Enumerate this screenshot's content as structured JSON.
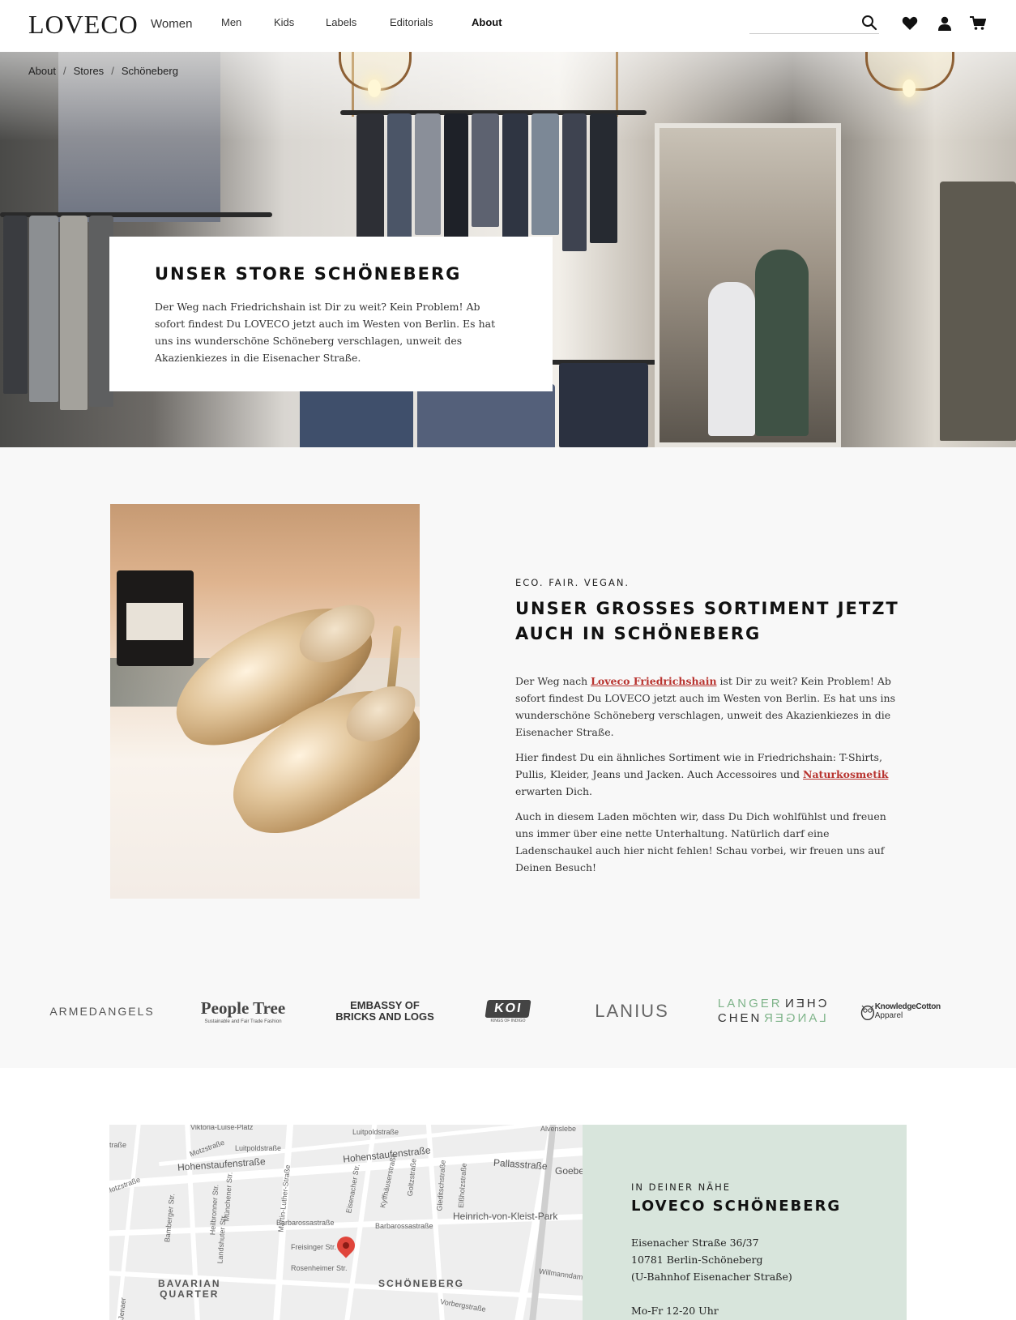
{
  "header": {
    "logo": "LOVECO",
    "nav": [
      {
        "label": "Women"
      },
      {
        "label": "Men"
      },
      {
        "label": "Kids"
      },
      {
        "label": "Labels"
      },
      {
        "label": "Editorials"
      },
      {
        "label": "About"
      }
    ],
    "active_nav": "About",
    "search": {
      "value": "",
      "placeholder": ""
    },
    "icons": [
      "search-icon",
      "heart-icon",
      "user-icon",
      "cart-icon"
    ]
  },
  "breadcrumb": [
    "About",
    "Stores",
    "Schöneberg"
  ],
  "hero": {
    "title": "UNSER STORE SCHÖNEBERG",
    "text": "Der Weg nach Friedrichshain ist Dir zu weit? Kein Problem! Ab sofort findest Du LOVECO jetzt auch im Westen von Berlin. Es hat uns ins wunderschöne Schöneberg verschlagen, unweit des Akazienkiezes in die Eisenacher Straße."
  },
  "sortiment": {
    "eyebrow": "ECO. FAIR. VEGAN.",
    "title": "UNSER GROSSES SORTIMENT JETZT AUCH IN SCHÖNEBERG",
    "p1_before": "Der Weg nach ",
    "p1_link": "Loveco Friedrichshain",
    "p1_after": " ist Dir zu weit? Kein Problem! Ab sofort findest Du LOVECO jetzt auch im Westen von Berlin. Es hat uns ins wunderschöne Schöneberg verschlagen, unweit des Akazienkiezes in die Eisenacher Straße.",
    "p2_before": " Hier findest Du ein ähnliches Sortiment wie in Friedrichshain: T-Shirts, Pullis, Kleider, Jeans und Jacken. Auch Accessoires und ",
    "p2_link": "Naturkosmetik",
    "p2_after": " erwarten Dich.",
    "p3": "Auch in diesem Laden möchten wir, dass Du Dich wohlfühlst und freuen uns immer über eine nette Unterhaltung. Natürlich darf eine Ladenschaukel auch hier nicht fehlen! Schau vorbei, wir freuen uns auf Deinen Besuch!",
    "accent_color": "#b8332f"
  },
  "brands": {
    "armedangels": "ARMEDANGELS",
    "people_tree": "People Tree",
    "people_tree_sub": "Sustainable and Fair Trade Fashion",
    "embassy_l1": "EMBASSY OF",
    "embassy_l2": "BRICKS AND LOGS",
    "koi": "KOI",
    "koi_sub": "KINGS OF INDIGO",
    "lanius": "LANIUS",
    "langer_1": "LANGER",
    "langer_2": "CHEN",
    "knowledge_1": "Knowledge",
    "knowledge_2": "Cotton",
    "knowledge_3": " Apparel"
  },
  "map": {
    "labels": {
      "viktoria": "Viktoria-Luise-Platz",
      "hohenstaufen_w": "Hohenstaufenstraße",
      "hohenstaufen_e": "Hohenstaufenstraße",
      "pallas": "Pallasstraße",
      "goeben": "Goeben",
      "luitpold": "Luitpoldstraße",
      "luitpold2": "Luitpoldstraße",
      "motz": "Motzstraße",
      "motz2": "Motzstraße",
      "martin_luther": "Martin-Luther-Straße",
      "barbarossa": "Barbarossastraße",
      "barbarossa2": "Barbarossastraße",
      "freisinger": "Freisinger Str.",
      "rosenheimer": "Rosenheimer Str.",
      "bamberger": "Bamberger Str.",
      "heilbronner": "Heilbronner Str.",
      "landshuter": "Landshuter Str.",
      "muenchener": "Münchener Str.",
      "eisenacher": "Eisenacher Str.",
      "kyffhaeuser": "Kyffhäuserstraße",
      "goltz": "Goltzstraße",
      "gleditsch": "Gleditschstraße",
      "elssholz": "Elßholzstraße",
      "kleist_park": "Heinrich-von-Kleist-Park",
      "willmanndamm": "Willmanndamm",
      "vorberg": "Vorbergstraße",
      "alvensleben": "Alvenslebe",
      "strasse": "traße",
      "jenaer": "Jenaer",
      "bavarian_1": "BAVARIAN",
      "bavarian_2": "QUARTER",
      "schoeneberg": "SCHÖNEBERG"
    }
  },
  "store": {
    "eyebrow": "IN DEINER NÄHE",
    "title": "LOVECO SCHÖNEBERG",
    "address_1": "Eisenacher Straße 36/37",
    "address_2": "10781 Berlin-Schöneberg",
    "address_3": "(U-Bahnhof Eisenacher Straße)",
    "hours": "Mo-Fr 12-20 Uhr",
    "background_color": "#d8e5dc"
  }
}
